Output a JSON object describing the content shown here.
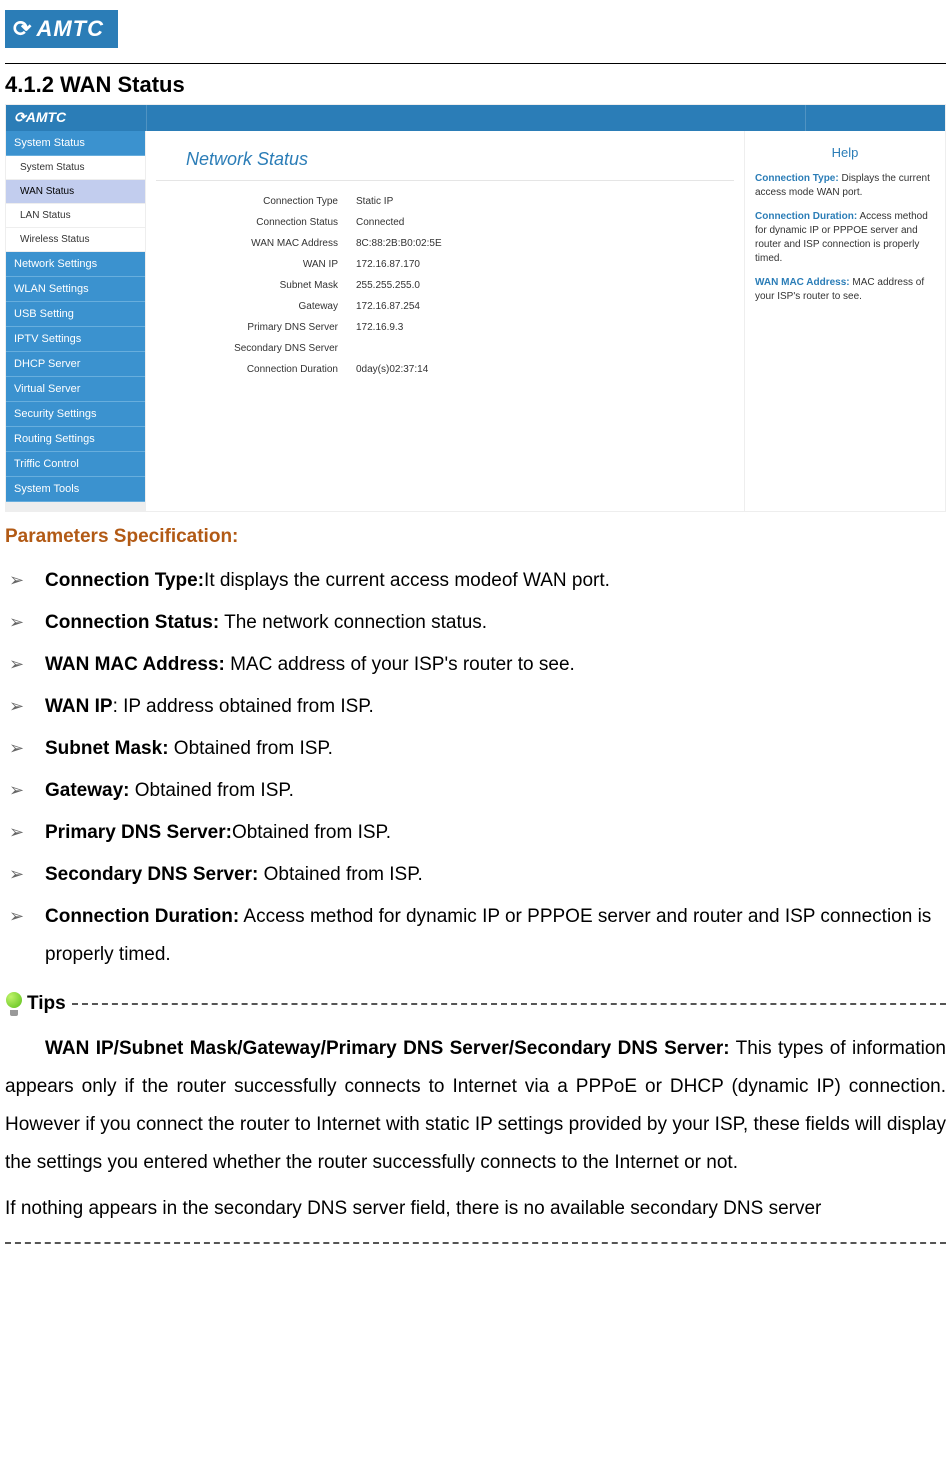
{
  "brand": "AMTC",
  "section_heading": "4.1.2 WAN Status",
  "screenshot": {
    "sidebar": {
      "group_system_status": "System Status",
      "items_system": [
        "System Status",
        "WAN Status",
        "LAN Status",
        "Wireless Status"
      ],
      "active_index": 1,
      "groups_rest": [
        "Network Settings",
        "WLAN Settings",
        "USB Setting",
        "IPTV Settings",
        "DHCP Server",
        "Virtual Server",
        "Security Settings",
        "Routing Settings",
        "Triffic Control",
        "System Tools"
      ]
    },
    "panel_title": "Network Status",
    "rows": [
      {
        "k": "Connection Type",
        "v": "Static IP"
      },
      {
        "k": "Connection Status",
        "v": "Connected"
      },
      {
        "k": "WAN MAC Address",
        "v": "8C:88:2B:B0:02:5E"
      },
      {
        "k": "WAN IP",
        "v": "172.16.87.170"
      },
      {
        "k": "Subnet Mask",
        "v": "255.255.255.0"
      },
      {
        "k": "Gateway",
        "v": "172.16.87.254"
      },
      {
        "k": "Primary DNS Server",
        "v": "172.16.9.3"
      },
      {
        "k": "Secondary DNS Server",
        "v": ""
      },
      {
        "k": "Connection Duration",
        "v": "0day(s)02:37:14"
      }
    ],
    "help": {
      "title": "Help",
      "items": [
        {
          "b": "Connection Type:",
          "t": " Displays the current access mode WAN port."
        },
        {
          "b": "Connection Duration:",
          "t": " Access method for dynamic IP or PPPOE server and router and ISP connection is properly timed."
        },
        {
          "b": "WAN MAC Address:",
          "t": " MAC address of your ISP's router to see."
        }
      ]
    }
  },
  "param_spec_title": "Parameters Specification:",
  "params": [
    {
      "b": "Connection Type:",
      "t": "It displays the current access modeof WAN port."
    },
    {
      "b": "Connection Status:",
      "t": " The network connection status."
    },
    {
      "b": "WAN MAC Address:",
      "t": " MAC address of your ISP's router to see."
    },
    {
      "b": "WAN IP",
      "t": ": IP address obtained from ISP."
    },
    {
      "b": "Subnet Mask:",
      "t": " Obtained from ISP."
    },
    {
      "b": "Gateway:",
      "t": " Obtained from ISP."
    },
    {
      "b": "Primary DNS Server:",
      "t": "Obtained from ISP."
    },
    {
      "b": "Secondary DNS Server:",
      "t": " Obtained from ISP."
    },
    {
      "b": "Connection Duration:",
      "t": " Access method for dynamic IP or PPPOE server and router and ISP connection is properly timed."
    }
  ],
  "tips_label": "Tips",
  "tips_body_bold": "WAN IP/Subnet Mask/Gateway/Primary DNS Server/Secondary DNS Server:",
  "tips_body_rest": " This types of information appears only if the router successfully connects to Internet via a PPPoE or DHCP (dynamic IP) connection. However if you connect the router to Internet with static IP settings provided by your ISP, these fields will display the settings you entered whether the router successfully connects to the Internet or not.",
  "tips_body_line2": "If nothing appears in the secondary DNS server field, there is no available secondary DNS server"
}
